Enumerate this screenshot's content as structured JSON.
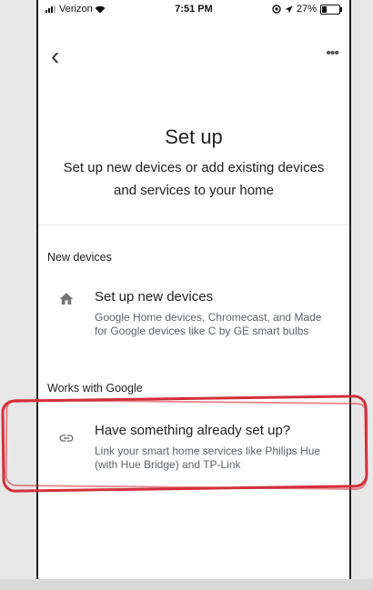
{
  "status_bar": {
    "carrier": "Verizon",
    "time": "7:51 PM",
    "battery": "27%",
    "battery_level": 0.27
  },
  "header": {
    "back_icon": "chevron-left-icon",
    "more_icon": "more-horizontal-icon"
  },
  "main": {
    "title": "Set up",
    "subtitle": "Set up new devices or add existing devices and services to your home"
  },
  "sections": {
    "new_devices": {
      "label": "New devices",
      "item": {
        "icon": "home-icon",
        "title": "Set up new devices",
        "description": "Google Home devices, Chromecast, and Made for Google devices like C by GE smart bulbs"
      }
    },
    "works_with_google": {
      "label": "Works with Google",
      "item": {
        "icon": "link-icon",
        "title": "Have something already set up?",
        "description": "Link your smart home services like Philips Hue (with Hue Bridge) and TP-Link"
      }
    }
  },
  "colors": {
    "highlight": "#d32f3a",
    "icon": "#757575",
    "secondary_text": "#5f6368"
  }
}
